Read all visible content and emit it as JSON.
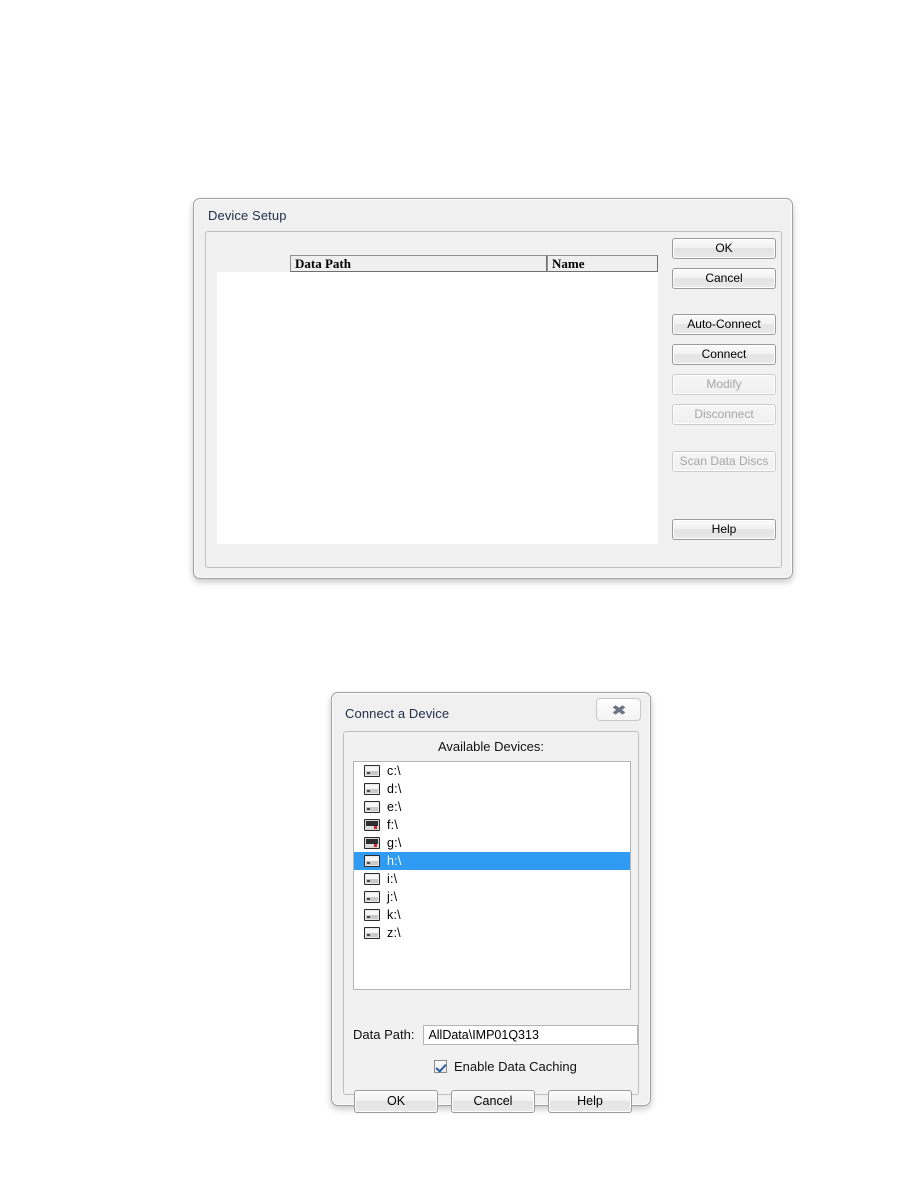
{
  "device_setup_dialog": {
    "title": "Device Setup",
    "table": {
      "columns": [
        "Data Path",
        "Name"
      ],
      "rows": []
    },
    "buttons": [
      {
        "label": "OK",
        "name": "ok-button",
        "enabled": true
      },
      {
        "label": "Cancel",
        "name": "cancel-button",
        "enabled": true
      },
      {
        "label": "Auto-Connect",
        "name": "auto-connect-button",
        "enabled": true
      },
      {
        "label": "Connect",
        "name": "connect-button",
        "enabled": true
      },
      {
        "label": "Modify",
        "name": "modify-button",
        "enabled": false
      },
      {
        "label": "Disconnect",
        "name": "disconnect-button",
        "enabled": false
      },
      {
        "label": "Scan Data Discs",
        "name": "scan-data-discs-button",
        "enabled": false
      },
      {
        "label": "Help",
        "name": "help-button",
        "enabled": true
      }
    ]
  },
  "connect_device_dialog": {
    "title": "Connect a Device",
    "close_button_glyph": "✖",
    "available_devices_label": "Available Devices:",
    "devices": [
      {
        "label": "c:\\",
        "icon": "hard-drive-icon",
        "selected": false
      },
      {
        "label": "d:\\",
        "icon": "hard-drive-icon",
        "selected": false
      },
      {
        "label": "e:\\",
        "icon": "hard-drive-icon",
        "selected": false
      },
      {
        "label": "f:\\",
        "icon": "optical-drive-icon",
        "selected": false
      },
      {
        "label": "g:\\",
        "icon": "optical-drive-icon",
        "selected": false
      },
      {
        "label": "h:\\",
        "icon": "hard-drive-icon",
        "selected": true
      },
      {
        "label": "i:\\",
        "icon": "hard-drive-icon",
        "selected": false
      },
      {
        "label": "j:\\",
        "icon": "hard-drive-icon",
        "selected": false
      },
      {
        "label": "k:\\",
        "icon": "hard-drive-icon",
        "selected": false
      },
      {
        "label": "z:\\",
        "icon": "hard-drive-icon",
        "selected": false
      }
    ],
    "data_path": {
      "label": "Data Path:",
      "value": "AllData\\IMP01Q313"
    },
    "enable_caching": {
      "label_prefix": "Enable Data Cachin",
      "label_accel": "g",
      "checked": true
    },
    "buttons": [
      {
        "label": "OK",
        "name": "ok-button"
      },
      {
        "label": "Cancel",
        "name": "cancel-button"
      },
      {
        "label": "Help",
        "name": "help-button"
      }
    ]
  },
  "colors": {
    "selection_blue": "#2f9bf2",
    "dialog_face": "#f0f0f0",
    "title_text": "#22304a",
    "disabled_text": "#a6a6a6"
  }
}
